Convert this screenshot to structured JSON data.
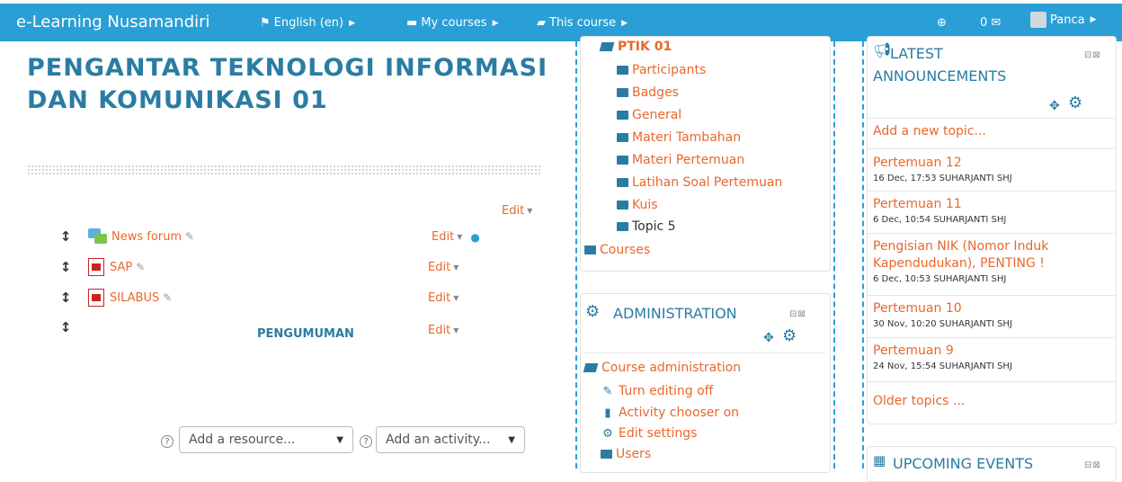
{
  "navbar": {
    "brand": "e-Learning Nusamandiri",
    "language": "English (en)",
    "my_courses": "My courses",
    "this_course": "This course",
    "messages_count": "0",
    "user": "Panca"
  },
  "course": {
    "title": "PENGANTAR TEKNOLOGI INFORMASI DAN KOMUNIKASI 01",
    "section_edit": "Edit",
    "activities": [
      {
        "name": "News forum",
        "edit": "Edit",
        "type": "forum"
      },
      {
        "name": "SAP",
        "edit": "Edit",
        "type": "pdf"
      },
      {
        "name": "SILABUS",
        "edit": "Edit",
        "type": "pdf"
      }
    ],
    "label_text": "PENGUMUMAN",
    "label_edit": "Edit",
    "add_resource": "Add a resource...",
    "add_activity": "Add an activity..."
  },
  "navigation": {
    "current_course": "PTIK 01",
    "items": [
      "Participants",
      "Badges",
      "General",
      "Materi Tambahan",
      "Materi Pertemuan",
      "Latihan Soal Pertemuan",
      "Kuis",
      "Topic 5"
    ],
    "courses": "Courses"
  },
  "administration": {
    "title": "ADMINISTRATION",
    "course_admin": "Course administration",
    "items": [
      "Turn editing off",
      "Activity chooser on",
      "Edit settings",
      "Users"
    ]
  },
  "announcements": {
    "title_line1": "LATEST",
    "title_line2": "ANNOUNCEMENTS",
    "add_topic": "Add a new topic...",
    "posts": [
      {
        "title": "Pertemuan 12",
        "meta": "16 Dec, 17:53 SUHARJANTI SHJ"
      },
      {
        "title": "Pertemuan 11",
        "meta": "6 Dec, 10:54 SUHARJANTI SHJ"
      },
      {
        "title": "Pengisian NIK (Nomor Induk Kapendudukan), PENTING !",
        "meta": "6 Dec, 10:53 SUHARJANTI SHJ"
      },
      {
        "title": "Pertemuan 10",
        "meta": "30 Nov, 10:20 SUHARJANTI SHJ"
      },
      {
        "title": "Pertemuan 9",
        "meta": "24 Nov, 15:54 SUHARJANTI SHJ"
      }
    ],
    "older": "Older topics ..."
  },
  "upcoming": {
    "title": "UPCOMING EVENTS"
  },
  "colors": {
    "navbar": "#2a9fd6",
    "link": "#e8682c",
    "heading": "#2a7ca3"
  }
}
